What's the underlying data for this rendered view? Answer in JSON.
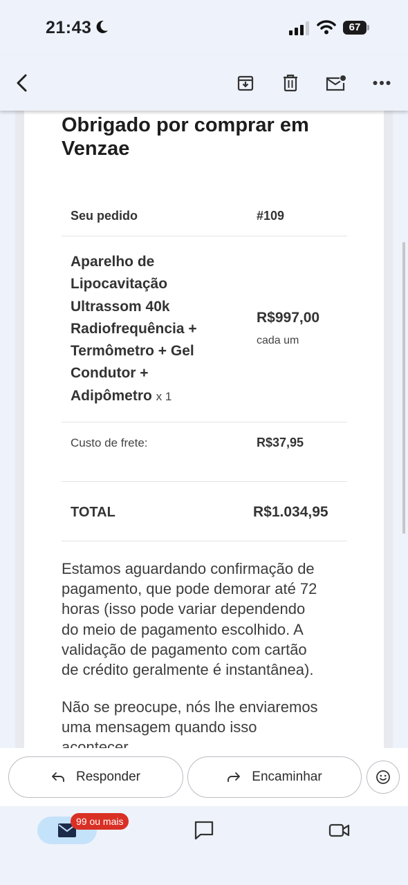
{
  "status_bar": {
    "time": "21:43",
    "battery": "67",
    "background_text": "Obrigado por comprar em Venzae"
  },
  "toolbar": {
    "back": "back-arrow-icon",
    "archive": "archive-icon",
    "delete": "trash-icon",
    "mark_unread": "mark-unread-icon",
    "more": "more-icon"
  },
  "email": {
    "heading": "Obrigado por comprar em Venzae",
    "order_label": "Seu pedido",
    "order_number": "#109",
    "product": {
      "lines": [
        "Aparelho de",
        "Lipocavitação",
        "Ultrassom 40k",
        "Radiofrequência +",
        "Termômetro + Gel",
        "Condutor +",
        "Adipômetro"
      ],
      "quantity": "x 1",
      "price": "R$997,00",
      "price_unit": "cada um"
    },
    "shipping_label": "Custo de frete:",
    "shipping_value": "R$37,95",
    "total_label": "TOTAL",
    "total_value": "R$1.034,95",
    "paragraph1_lines": [
      "Estamos aguardando confirmação de",
      "pagamento, que pode demorar até 72",
      "horas (isso pode variar dependendo",
      "do meio de pagamento escolhido. A",
      "validação de pagamento com cartão",
      "de crédito geralmente é instantânea)."
    ],
    "paragraph2_lines": [
      "Não se preocupe, nós lhe enviaremos",
      "uma mensagem quando isso",
      "acontecer."
    ]
  },
  "reply_bar": {
    "reply_label": "Responder",
    "forward_label": "Encaminhar"
  },
  "bottom_nav": {
    "mail_badge": "99 ou mais"
  },
  "colors": {
    "accent_badge": "#d93025",
    "nav_active": "#c5e2fb",
    "chrome_bg": "#eef2fa"
  }
}
